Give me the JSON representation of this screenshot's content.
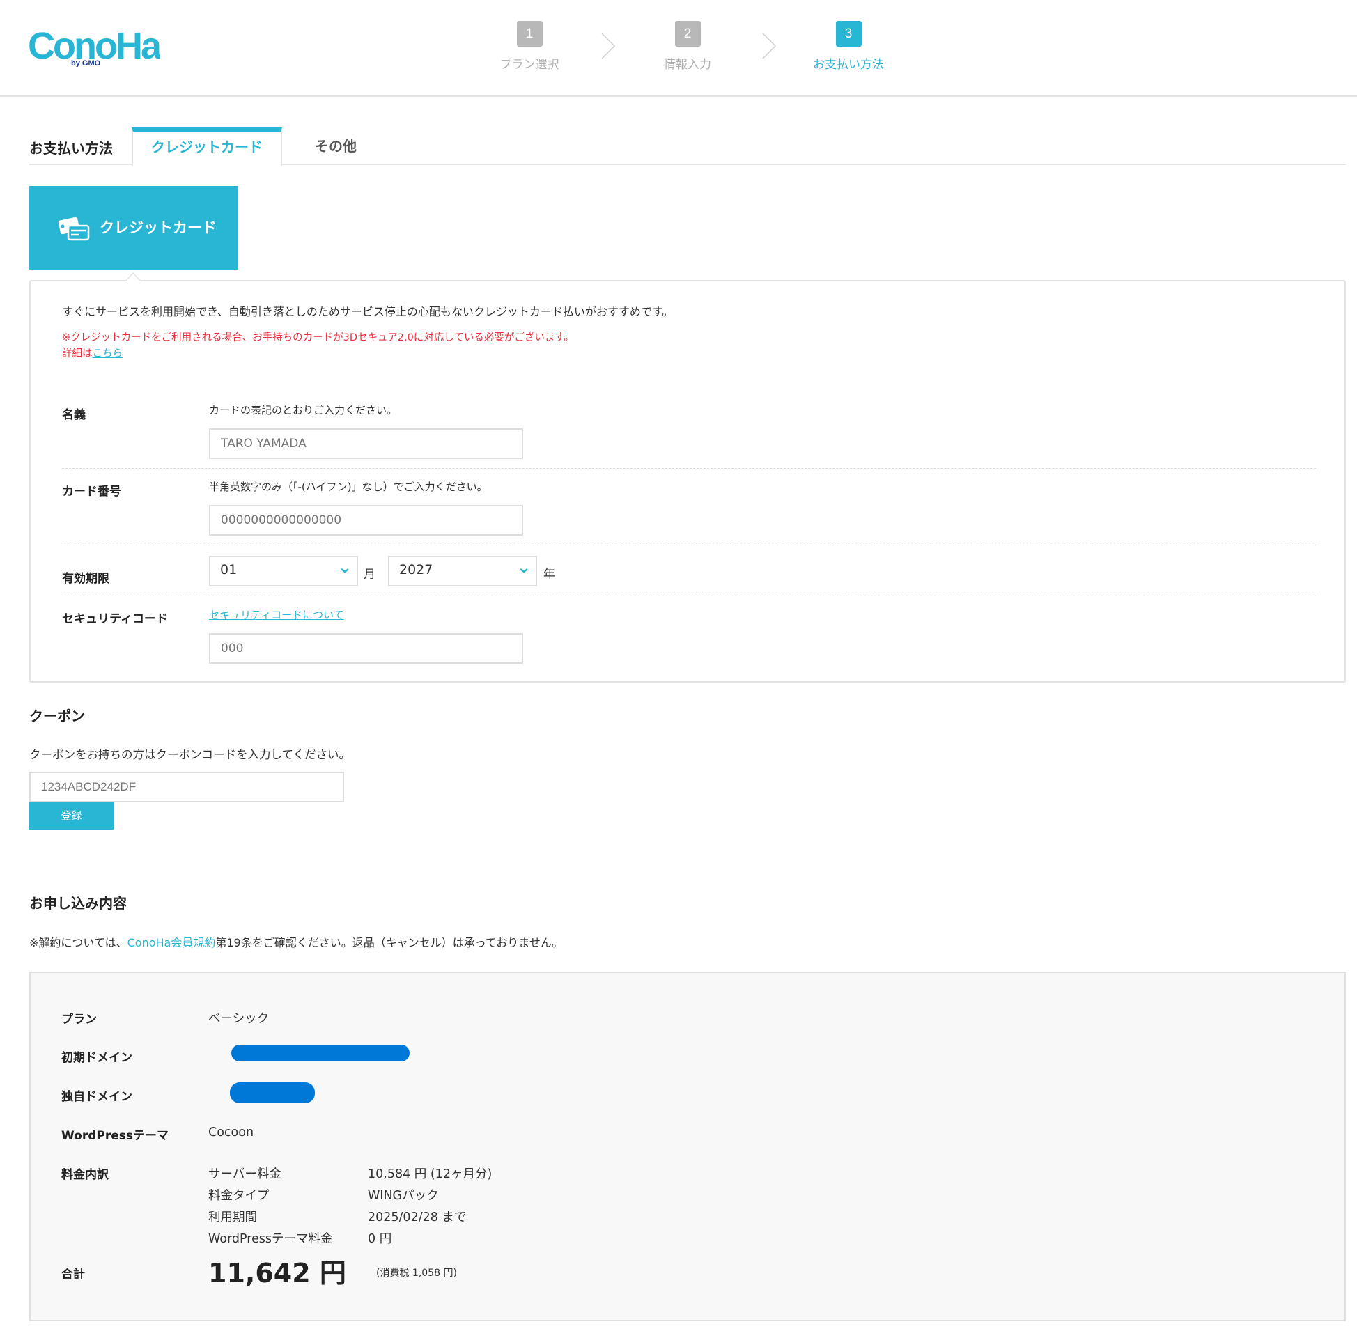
{
  "brand": {
    "name": "ConoHa",
    "sub": "by GMO",
    "accent_color": "#28b6d4",
    "warning_color": "#e8303f"
  },
  "steps": [
    {
      "number": "1",
      "label": "プラン選択",
      "active": false
    },
    {
      "number": "2",
      "label": "情報入力",
      "active": false
    },
    {
      "number": "3",
      "label": "お支払い方法",
      "active": true
    }
  ],
  "tabs": {
    "title": "お支払い方法",
    "items": [
      {
        "label": "クレジットカード",
        "active": true
      },
      {
        "label": "その他",
        "active": false
      }
    ]
  },
  "method_tile": {
    "icon": "credit-card-icon",
    "label": "クレジットカード"
  },
  "card_panel": {
    "intro": "すぐにサービスを利用開始でき、自動引き落としのためサービス停止の心配もないクレジットカード払いがおすすめです。",
    "warning": "※クレジットカードをご利用される場合、お手持ちのカードが3Dセキュア2.0に対応している必要がございます。",
    "details_prefix": "詳細は",
    "details_link": "こちら",
    "fields": {
      "name": {
        "label": "名義",
        "hint": "カードの表記のとおりご入力ください。",
        "placeholder": "TARO YAMADA",
        "value": ""
      },
      "number": {
        "label": "カード番号",
        "hint": "半角英数字のみ（「-(ハイフン)」なし）でご入力ください。",
        "placeholder": "0000000000000000",
        "value": ""
      },
      "expiry": {
        "label": "有効期限",
        "month": "01",
        "month_unit": "月",
        "year": "2027",
        "year_unit": "年"
      },
      "cvc": {
        "label": "セキュリティコード",
        "link": "セキュリティコードについて",
        "placeholder": "000",
        "value": ""
      }
    }
  },
  "coupon": {
    "title": "クーポン",
    "description": "クーポンをお持ちの方はクーポンコードを入力してください。",
    "placeholder": "1234ABCD242DF",
    "value": "",
    "button": "登録"
  },
  "order": {
    "title": "お申し込み内容",
    "note_prefix": "※解約については、",
    "note_link": "ConoHa会員規約",
    "note_suffix": "第19条をご確認ください。返品（キャンセル）は承っておりません。",
    "rows": {
      "plan": {
        "label": "プラン",
        "value": "ベーシック"
      },
      "initial_domain": {
        "label": "初期ドメイン",
        "value": "[redacted]"
      },
      "custom_domain": {
        "label": "独自ドメイン",
        "value": "[redacted]"
      },
      "theme": {
        "label": "WordPressテーマ",
        "value": "Cocoon"
      }
    },
    "fees": {
      "label": "料金内訳",
      "items": [
        {
          "name": "サーバー料金",
          "value": "10,584 円 (12ヶ月分)"
        },
        {
          "name": "料金タイプ",
          "value": "WINGパック"
        },
        {
          "name": "利用期間",
          "value": "2025/02/28 まで"
        },
        {
          "name": "WordPressテーマ料金",
          "value": "0 円"
        }
      ]
    },
    "total": {
      "label": "合計",
      "amount": "11,642 円",
      "tax": "(消費税 1,058 円)"
    }
  }
}
